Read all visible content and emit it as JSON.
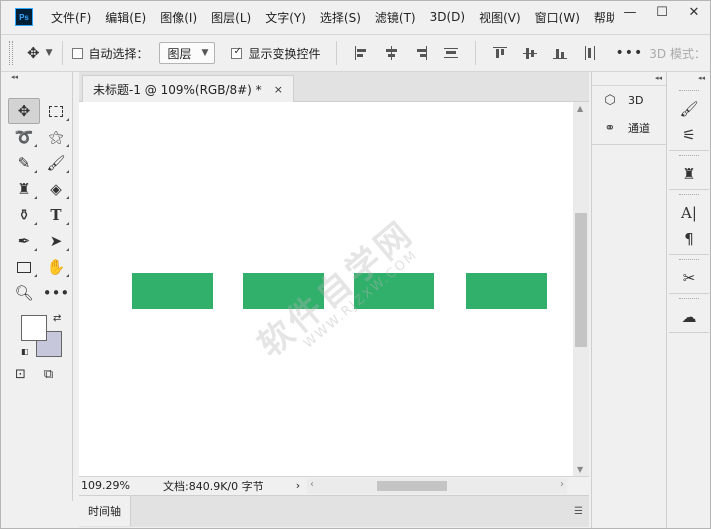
{
  "app": {
    "logo": "Ps"
  },
  "menu": [
    "文件(F)",
    "编辑(E)",
    "图像(I)",
    "图层(L)",
    "文字(Y)",
    "选择(S)",
    "滤镜(T)",
    "3D(D)",
    "视图(V)",
    "窗口(W)",
    "帮助"
  ],
  "window_controls": {
    "minimize": "—",
    "maximize": "☐",
    "close": "✕"
  },
  "options": {
    "auto_select_label": "自动选择：",
    "auto_select_checked": false,
    "layer_select_value": "图层",
    "show_transform_label": "显示变换控件",
    "show_transform_checked": true,
    "more": "•••",
    "mode_3d_label": "3D 模式："
  },
  "document": {
    "tab_title": "未标题-1 @ 109%(RGB/8#) *",
    "close_glyph": "×",
    "shapes_color": "#31b06b",
    "watermark": "软件自学网",
    "watermark_sub": "WWW.RJZXW.COM"
  },
  "status": {
    "zoom": "109.29%",
    "doc_info": "文档:840.9K/0 字节",
    "arrow": "›"
  },
  "timeline": {
    "tab_label": "时间轴"
  },
  "panel3d": {
    "items": [
      {
        "icon": "cube-icon",
        "label": "3D"
      },
      {
        "icon": "channels-icon",
        "label": "通道"
      }
    ]
  },
  "colors": {
    "foreground": "#ffffff",
    "background": "#c7c7dc"
  }
}
